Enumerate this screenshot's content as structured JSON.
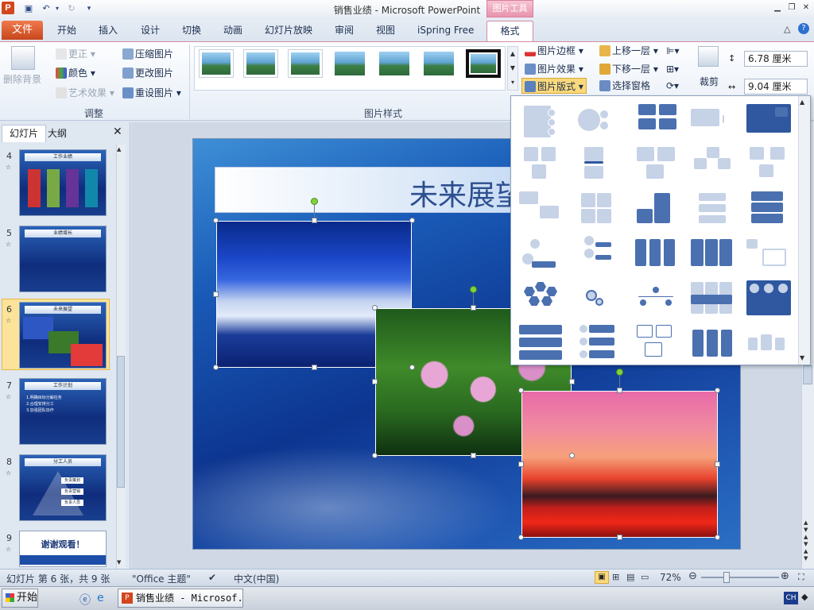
{
  "app": {
    "title": "销售业绩 - Microsoft PowerPoint",
    "context_tab_group": "图片工具",
    "logo_letter": "P"
  },
  "tabs": [
    "文件",
    "开始",
    "插入",
    "设计",
    "切换",
    "动画",
    "幻灯片放映",
    "审阅",
    "视图",
    "iSpring Free",
    "格式"
  ],
  "ribbon": {
    "adjust": {
      "remove_background": "删除背景",
      "corrections": "更正",
      "color": "颜色",
      "artistic_effects": "艺术效果",
      "compress": "压缩图片",
      "change_picture": "更改图片",
      "reset_picture": "重设图片",
      "group_label": "调整"
    },
    "styles": {
      "group_label": "图片样式"
    },
    "picture_options": {
      "border": "图片边框",
      "effects": "图片效果",
      "layout": "图片版式"
    },
    "arrange": {
      "bring_forward": "上移一层",
      "send_backward": "下移一层",
      "selection_pane": "选择窗格"
    },
    "size": {
      "crop": "裁剪",
      "height": "6.78 厘米",
      "width": "9.04 厘米"
    }
  },
  "left_panel": {
    "tab_slides": "幻灯片",
    "tab_outline": "大纲",
    "close": "✕",
    "slides": [
      {
        "num": "4",
        "bar": "工作业绩"
      },
      {
        "num": "5",
        "bar": "业绩增长"
      },
      {
        "num": "6",
        "bar": "未来展望"
      },
      {
        "num": "7",
        "bar": "工作计划"
      },
      {
        "num": "8",
        "bar": "分工人员"
      },
      {
        "num": "9",
        "bar": "谢谢观看！"
      }
    ],
    "slide7_lines": "1.明确目标分解任务\n2.合理安排分工\n3.加强团队协作",
    "slide8_items": [
      "负责策划",
      "负责营销",
      "负责人员"
    ]
  },
  "slide": {
    "title": "未来展望"
  },
  "statusbar": {
    "slide_info": "幻灯片 第 6 张，共 9 张",
    "theme": "\"Office 主题\"",
    "language": "中文(中国)",
    "zoom": "72%"
  },
  "taskbar": {
    "start": "开始",
    "ppt_task": "销售业绩 - Microsof...",
    "ime": "CH"
  },
  "colors": {
    "file_tab": "#d2471d",
    "context_tab": "#e893ad",
    "slide_bg": "#1a5cb8",
    "layout_blue": "#4a70b0"
  }
}
